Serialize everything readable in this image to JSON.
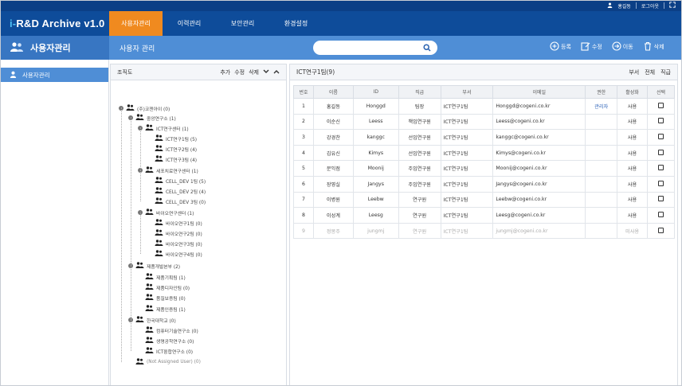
{
  "topbar": {
    "user_name": "홍길동",
    "logout_label": "로그아웃"
  },
  "app": {
    "logo_prefix": "i-",
    "logo_text": "R&D Archive v1.0"
  },
  "nav": {
    "tabs": [
      {
        "label": "사용자관리",
        "active": true
      },
      {
        "label": "이력관리",
        "active": false
      },
      {
        "label": "보안관리",
        "active": false
      },
      {
        "label": "환경설정",
        "active": false
      }
    ]
  },
  "system_title": "사용자관리",
  "page_title": "사용자 관리",
  "search": {
    "value": "",
    "placeholder": ""
  },
  "actions": {
    "register": "등록",
    "edit": "수정",
    "move": "이동",
    "delete": "삭제"
  },
  "left_menu": {
    "items": [
      {
        "label": "사용자관리",
        "icon": "user-icon"
      }
    ]
  },
  "tree_panel": {
    "title": "조직도",
    "add": "추가",
    "edit": "수정",
    "delete": "삭제",
    "nodes": [
      {
        "label": "(주)코젠아이 (0)"
      },
      {
        "label": "중앙연구소 (1)"
      },
      {
        "label": "ICT연구센터 (1)"
      },
      {
        "label": "ICT연구1팀 (5)"
      },
      {
        "label": "ICT연구2팀 (4)"
      },
      {
        "label": "ICT연구3팀 (4)"
      },
      {
        "label": "세포치료연구센터 (1)"
      },
      {
        "label": "CELL_DEV 1팀 (5)"
      },
      {
        "label": "CELL_DEV 2팀 (4)"
      },
      {
        "label": "CELL_DEV 3팀 (0)"
      },
      {
        "label": "바이오연구센터 (1)"
      },
      {
        "label": "바이오연구1팀 (0)"
      },
      {
        "label": "바이오연구2팀 (0)"
      },
      {
        "label": "바이오연구3팀 (0)"
      },
      {
        "label": "바이오연구4팀 (0)"
      },
      {
        "label": "제품개발본부 (2)"
      },
      {
        "label": "제품기획팀 (1)"
      },
      {
        "label": "제품디자인팀 (0)"
      },
      {
        "label": "품질보증팀 (0)"
      },
      {
        "label": "제품인증팀 (1)"
      },
      {
        "label": "한국대학교 (0)"
      },
      {
        "label": "컴퓨터기술연구소 (0)"
      },
      {
        "label": "생명공학연구소 (0)"
      },
      {
        "label": "ICT융합연구소 (0)"
      },
      {
        "label": "(Not Assigned User) (0)"
      }
    ]
  },
  "grid_panel": {
    "title": "ICT연구1팀(9)",
    "links": {
      "dept": "부서",
      "all": "전체",
      "rank": "직급"
    },
    "columns": [
      "번호",
      "이름",
      "ID",
      "직급",
      "부서",
      "이메일",
      "권한",
      "활성화",
      "선택"
    ],
    "rows": [
      {
        "no": "1",
        "name": "홍길동",
        "id": "Honggd",
        "rank": "팀장",
        "dept": "ICT연구1팀",
        "email": "Honggd@cogeni.co.kr",
        "role": "관리자",
        "status": "사용",
        "inactive": false
      },
      {
        "no": "2",
        "name": "이순신",
        "id": "Leess",
        "rank": "책임연구원",
        "dept": "ICT연구1팀",
        "email": "Leess@cogeni.co.kr",
        "role": "",
        "status": "사용",
        "inactive": false
      },
      {
        "no": "3",
        "name": "강경찬",
        "id": "kanggc",
        "rank": "선임연구원",
        "dept": "ICT연구1팀",
        "email": "kanggc@cogeni.co.kr",
        "role": "",
        "status": "사용",
        "inactive": false
      },
      {
        "no": "4",
        "name": "김유신",
        "id": "Kimys",
        "rank": "선임연구원",
        "dept": "ICT연구1팀",
        "email": "Kimys@cogeni.co.kr",
        "role": "",
        "status": "사용",
        "inactive": false
      },
      {
        "no": "5",
        "name": "문익점",
        "id": "Moonij",
        "rank": "주임연구원",
        "dept": "ICT연구1팀",
        "email": "Moonij@cogeni.co.kr",
        "role": "",
        "status": "사용",
        "inactive": false
      },
      {
        "no": "6",
        "name": "장영실",
        "id": "Jangys",
        "rank": "주임연구원",
        "dept": "ICT연구1팀",
        "email": "Jangys@cogeni.co.kr",
        "role": "",
        "status": "사용",
        "inactive": false
      },
      {
        "no": "7",
        "name": "이병원",
        "id": "Leebw",
        "rank": "연구원",
        "dept": "ICT연구1팀",
        "email": "Leebw@cogeni.co.kr",
        "role": "",
        "status": "사용",
        "inactive": false
      },
      {
        "no": "8",
        "name": "이성계",
        "id": "Leesg",
        "rank": "연구원",
        "dept": "ICT연구1팀",
        "email": "Leesg@cogeni.co.kr",
        "role": "",
        "status": "사용",
        "inactive": false
      },
      {
        "no": "9",
        "name": "정몽주",
        "id": "jungmj",
        "rank": "연구원",
        "dept": "ICT연구1팀",
        "email": "jungmj@cogeni.co.kr",
        "role": "",
        "status": "미사용",
        "inactive": true
      }
    ]
  },
  "colors": {
    "header": "#0e4c9a",
    "active_tab": "#f08a1f",
    "subheader": "#4f8ed6"
  }
}
